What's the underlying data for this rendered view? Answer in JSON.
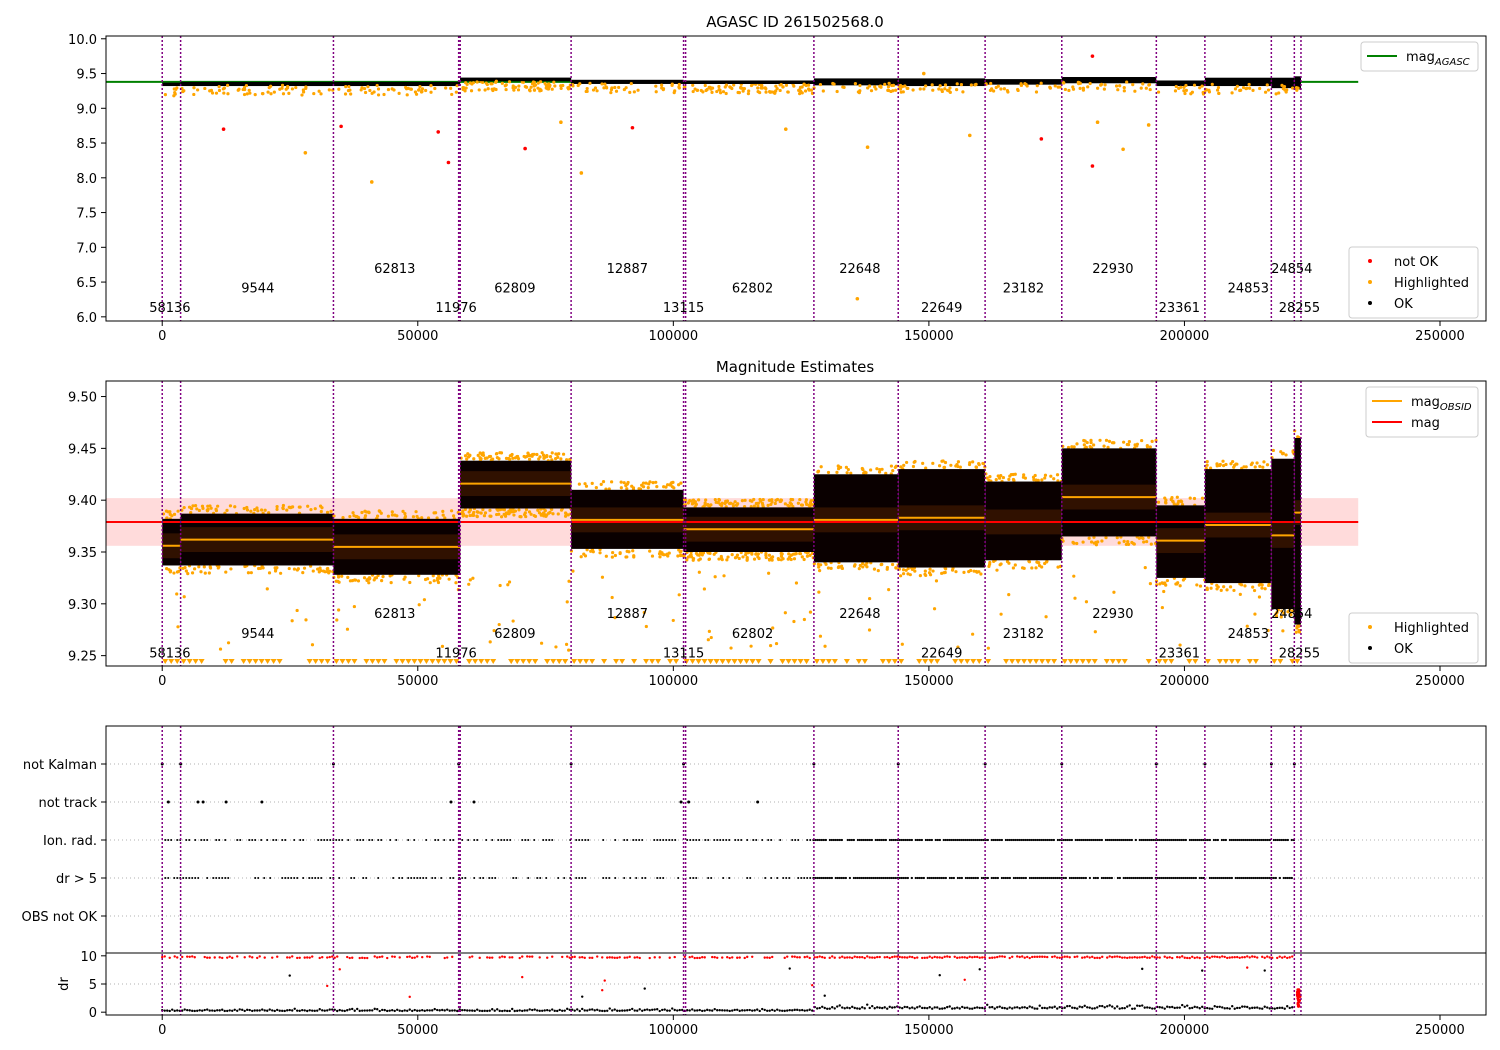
{
  "chart_data": [
    {
      "type": "scatter",
      "title": "AGASC ID 261502568.0",
      "xlim": [
        -11000,
        259000
      ],
      "ylim": [
        5.94,
        10.04
      ],
      "xticks": [
        0,
        50000,
        100000,
        150000,
        200000,
        250000
      ],
      "yticks": [
        6.0,
        6.5,
        7.0,
        7.5,
        8.0,
        8.5,
        9.0,
        9.5,
        10.0
      ],
      "ytick_labels": [
        "6.0",
        "6.5",
        "7.0",
        "7.5",
        "8.0",
        "8.5",
        "9.0",
        "9.5",
        "10.0"
      ],
      "legend_upper": {
        "placement": "top-right",
        "entries": [
          {
            "label": "mag",
            "subscript": "AGASC",
            "color": "#008000",
            "kind": "line"
          }
        ]
      },
      "legend_lower": {
        "placement": "bottom-right",
        "entries": [
          {
            "label": "not OK",
            "color": "#ff0000",
            "kind": "dot"
          },
          {
            "label": "Highlighted",
            "color": "#ffa500",
            "kind": "dot"
          },
          {
            "label": "OK",
            "color": "#000000",
            "kind": "dot"
          }
        ]
      },
      "mag_agasc": 9.38,
      "mag_agasc_x_range": [
        -11000,
        234000
      ],
      "segments": [
        {
          "obsid": "58136",
          "x0": 0,
          "x1": 3600,
          "level": 9.34,
          "ok_range": [
            9.32,
            9.37
          ],
          "label_y": 6.13
        },
        {
          "obsid": "9544",
          "x0": 3600,
          "x1": 33500,
          "level": 9.35,
          "ok_range": [
            9.32,
            9.38
          ],
          "label_y": 6.41
        },
        {
          "obsid": "62813",
          "x0": 33500,
          "x1": 58300,
          "level": 9.35,
          "ok_range": [
            9.32,
            9.38
          ],
          "label_y": 6.69
        },
        {
          "obsid": "11976",
          "x0": 58300,
          "x1": 80000,
          "level": 9.41,
          "ok_range": [
            9.39,
            9.44
          ],
          "label_y": 6.13
        },
        {
          "obsid": "62809",
          "x0": 58300,
          "x1": 80000,
          "level": 9.41,
          "ok_range": [
            9.39,
            9.44
          ],
          "label_y": 6.41
        },
        {
          "obsid": "12887",
          "x0": 80000,
          "x1": 102000,
          "level": 9.38,
          "ok_range": [
            9.35,
            9.41
          ],
          "label_y": 6.69
        },
        {
          "obsid": "13115",
          "x0": 102000,
          "x1": 127500,
          "level": 9.37,
          "ok_range": [
            9.35,
            9.4
          ],
          "label_y": 6.13
        },
        {
          "obsid": "62802",
          "x0": 102000,
          "x1": 127500,
          "level": 9.37,
          "ok_range": [
            9.35,
            9.4
          ],
          "label_y": 6.41
        },
        {
          "obsid": "22648",
          "x0": 127500,
          "x1": 144000,
          "level": 9.38,
          "ok_range": [
            9.33,
            9.43
          ],
          "label_y": 6.69
        },
        {
          "obsid": "22649",
          "x0": 144000,
          "x1": 161000,
          "level": 9.38,
          "ok_range": [
            9.32,
            9.43
          ],
          "label_y": 6.13
        },
        {
          "obsid": "23182",
          "x0": 161000,
          "x1": 176000,
          "level": 9.38,
          "ok_range": [
            9.34,
            9.42
          ],
          "label_y": 6.41
        },
        {
          "obsid": "22930",
          "x0": 176000,
          "x1": 194500,
          "level": 9.4,
          "ok_range": [
            9.36,
            9.45
          ],
          "label_y": 6.69
        },
        {
          "obsid": "23361",
          "x0": 194500,
          "x1": 204000,
          "level": 9.36,
          "ok_range": [
            9.32,
            9.4
          ],
          "label_y": 6.13
        },
        {
          "obsid": "24853",
          "x0": 204000,
          "x1": 217000,
          "level": 9.37,
          "ok_range": [
            9.32,
            9.44
          ],
          "label_y": 6.41
        },
        {
          "obsid": "24854",
          "x0": 217000,
          "x1": 221500,
          "level": 9.36,
          "ok_range": [
            9.29,
            9.44
          ],
          "label_y": 6.69
        },
        {
          "obsid": "28255",
          "x0": 221500,
          "x1": 222800,
          "level": 9.39,
          "ok_range": [
            9.27,
            9.46
          ],
          "label_y": 6.13
        }
      ],
      "obsid_label_x": [
        1500,
        18700,
        45500,
        57500,
        69000,
        91000,
        102000,
        115500,
        136500,
        152500,
        168500,
        186000,
        199000,
        212500,
        221000,
        222500
      ],
      "boundaries": [
        0,
        3600,
        33500,
        58000,
        58300,
        80000,
        102000,
        102400,
        127500,
        144000,
        161000,
        176000,
        194500,
        204000,
        217000,
        221500,
        222800
      ],
      "not_ok_points": [
        [
          12000,
          8.7
        ],
        [
          35000,
          8.74
        ],
        [
          54000,
          8.66
        ],
        [
          56000,
          8.22
        ],
        [
          71000,
          8.42
        ],
        [
          92000,
          8.72
        ],
        [
          172000,
          8.56
        ],
        [
          182000,
          9.75
        ],
        [
          182000,
          8.17
        ]
      ],
      "highlighted_points": [
        [
          28000,
          8.36
        ],
        [
          41000,
          7.94
        ],
        [
          78000,
          8.8
        ],
        [
          82000,
          8.07
        ],
        [
          122000,
          8.7
        ],
        [
          136000,
          6.26
        ],
        [
          138000,
          8.44
        ],
        [
          158000,
          8.61
        ],
        [
          183000,
          8.8
        ],
        [
          188000,
          8.41
        ],
        [
          193000,
          8.76
        ],
        [
          149000,
          9.5
        ]
      ]
    },
    {
      "type": "scatter",
      "title": "Magnitude Estimates",
      "xlim": [
        -11000,
        259000
      ],
      "ylim": [
        9.24,
        9.515
      ],
      "xticks": [
        0,
        50000,
        100000,
        150000,
        200000,
        250000
      ],
      "yticks": [
        9.25,
        9.3,
        9.35,
        9.4,
        9.45,
        9.5
      ],
      "ytick_labels": [
        "9.25",
        "9.30",
        "9.35",
        "9.40",
        "9.45",
        "9.50"
      ],
      "legend_upper": {
        "placement": "top-right",
        "entries": [
          {
            "label": "mag",
            "subscript": "OBSID",
            "color": "#ffa500",
            "kind": "line"
          },
          {
            "label": "mag",
            "color": "#ff0000",
            "kind": "line"
          }
        ]
      },
      "legend_lower": {
        "placement": "bottom-right",
        "entries": [
          {
            "label": "Highlighted",
            "color": "#ffa500",
            "kind": "dot"
          },
          {
            "label": "OK",
            "color": "#000000",
            "kind": "dot"
          }
        ]
      },
      "mag": 9.379,
      "mag_band": [
        9.356,
        9.402
      ],
      "mag_x_range": [
        -11000,
        234000
      ],
      "segments": [
        {
          "obsid": "58136",
          "x0": 0,
          "x1": 3600,
          "mag_obsid": 9.356,
          "ok_range": [
            9.337,
            9.382
          ],
          "label_y": 9.252
        },
        {
          "obsid": "9544",
          "x0": 3600,
          "x1": 33500,
          "mag_obsid": 9.362,
          "ok_range": [
            9.337,
            9.387
          ],
          "label_y": 9.271
        },
        {
          "obsid": "62813",
          "x0": 33500,
          "x1": 58300,
          "mag_obsid": 9.355,
          "ok_range": [
            9.328,
            9.382
          ],
          "label_y": 9.29
        },
        {
          "obsid": "11976",
          "x0": 58300,
          "x1": 80000,
          "mag_obsid": 9.416,
          "ok_range": [
            9.392,
            9.438
          ],
          "label_y": 9.252
        },
        {
          "obsid": "62809",
          "x0": 58300,
          "x1": 80000,
          "mag_obsid": 9.416,
          "ok_range": [
            9.392,
            9.438
          ],
          "label_y": 9.271
        },
        {
          "obsid": "12887",
          "x0": 80000,
          "x1": 102000,
          "mag_obsid": 9.381,
          "ok_range": [
            9.353,
            9.41
          ],
          "label_y": 9.29
        },
        {
          "obsid": "13115",
          "x0": 102000,
          "x1": 127500,
          "mag_obsid": 9.372,
          "ok_range": [
            9.35,
            9.393
          ],
          "label_y": 9.252
        },
        {
          "obsid": "62802",
          "x0": 102000,
          "x1": 127500,
          "mag_obsid": 9.372,
          "ok_range": [
            9.35,
            9.393
          ],
          "label_y": 9.271
        },
        {
          "obsid": "22648",
          "x0": 127500,
          "x1": 144000,
          "mag_obsid": 9.381,
          "ok_range": [
            9.34,
            9.425
          ],
          "label_y": 9.29
        },
        {
          "obsid": "22649",
          "x0": 144000,
          "x1": 161000,
          "mag_obsid": 9.383,
          "ok_range": [
            9.335,
            9.43
          ],
          "label_y": 9.252
        },
        {
          "obsid": "23182",
          "x0": 161000,
          "x1": 176000,
          "mag_obsid": 9.379,
          "ok_range": [
            9.342,
            9.418
          ],
          "label_y": 9.271
        },
        {
          "obsid": "22930",
          "x0": 176000,
          "x1": 194500,
          "mag_obsid": 9.403,
          "ok_range": [
            9.365,
            9.45
          ],
          "label_y": 9.29
        },
        {
          "obsid": "23361",
          "x0": 194500,
          "x1": 204000,
          "mag_obsid": 9.361,
          "ok_range": [
            9.325,
            9.395
          ],
          "label_y": 9.252
        },
        {
          "obsid": "24853",
          "x0": 204000,
          "x1": 217000,
          "mag_obsid": 9.376,
          "ok_range": [
            9.32,
            9.43
          ],
          "label_y": 9.271
        },
        {
          "obsid": "24854",
          "x0": 217000,
          "x1": 221500,
          "mag_obsid": 9.366,
          "ok_range": [
            9.295,
            9.44
          ],
          "label_y": 9.29
        },
        {
          "obsid": "28255",
          "x0": 221500,
          "x1": 222800,
          "mag_obsid": 9.388,
          "ok_range": [
            9.28,
            9.46
          ],
          "label_y": 9.252
        }
      ],
      "obsid_label_x": [
        1500,
        18700,
        45500,
        57500,
        69000,
        91000,
        102000,
        115500,
        136500,
        152500,
        168500,
        186000,
        199000,
        212500,
        221000,
        222500
      ],
      "boundaries": [
        0,
        3600,
        33500,
        58000,
        58300,
        80000,
        102000,
        102400,
        127500,
        144000,
        161000,
        176000,
        194500,
        204000,
        217000,
        221500,
        222800
      ]
    },
    {
      "type": "scatter",
      "xlim": [
        -11000,
        259000
      ],
      "xticks": [
        0,
        50000,
        100000,
        150000,
        200000,
        250000
      ],
      "flag_rows": [
        "not Kalman",
        "not track",
        "Ion. rad.",
        "dr > 5",
        "OBS not OK"
      ],
      "dr_ylabel": "dr",
      "dr_yticks": [
        0,
        5,
        10
      ],
      "dr_ylim": [
        -0.5,
        10.5
      ],
      "boundaries": [
        0,
        3600,
        33500,
        58000,
        58300,
        80000,
        102000,
        102400,
        127500,
        144000,
        161000,
        176000,
        194500,
        204000,
        217000,
        221500,
        222800
      ],
      "not_kalman_x": [
        0,
        3600,
        33500,
        58000,
        80000,
        102000,
        127500,
        144000,
        161000,
        176000,
        194500,
        204000,
        217000,
        221500
      ],
      "not_track_x": [
        1200,
        7000,
        8000,
        12500,
        19500,
        56500,
        61000,
        101500,
        103000,
        116500
      ],
      "dense_ranges": [
        [
          127500,
          221500
        ]
      ],
      "sparse_ranges": [
        [
          0,
          127500
        ]
      ]
    }
  ]
}
